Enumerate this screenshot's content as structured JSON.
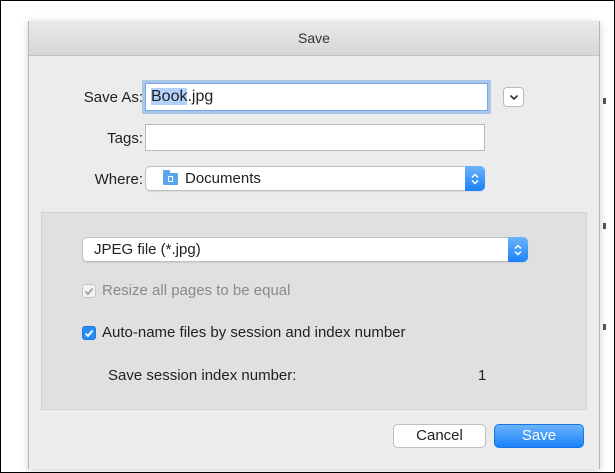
{
  "dialog": {
    "title": "Save",
    "save_as_label": "Save As:",
    "filename_stem": "Book",
    "filename_ext": ".jpg",
    "tags_label": "Tags:",
    "tags_value": "",
    "where_label": "Where:",
    "where_value": "Documents",
    "where_icon": "folder-icon",
    "expand_icon": "chevron-down-icon"
  },
  "options": {
    "format_value": "JPEG file (*.jpg)",
    "resize_label": "Resize all pages to be equal",
    "resize_checked": true,
    "resize_enabled": false,
    "autoname_label": "Auto-name files by session and index number",
    "autoname_checked": true,
    "session_index_label": "Save session index number:",
    "session_index_value": "1"
  },
  "buttons": {
    "cancel": "Cancel",
    "save": "Save"
  },
  "colors": {
    "accent": "#1a82fb",
    "selection": "#b3d2fb",
    "sheet_bg": "#ececec"
  }
}
